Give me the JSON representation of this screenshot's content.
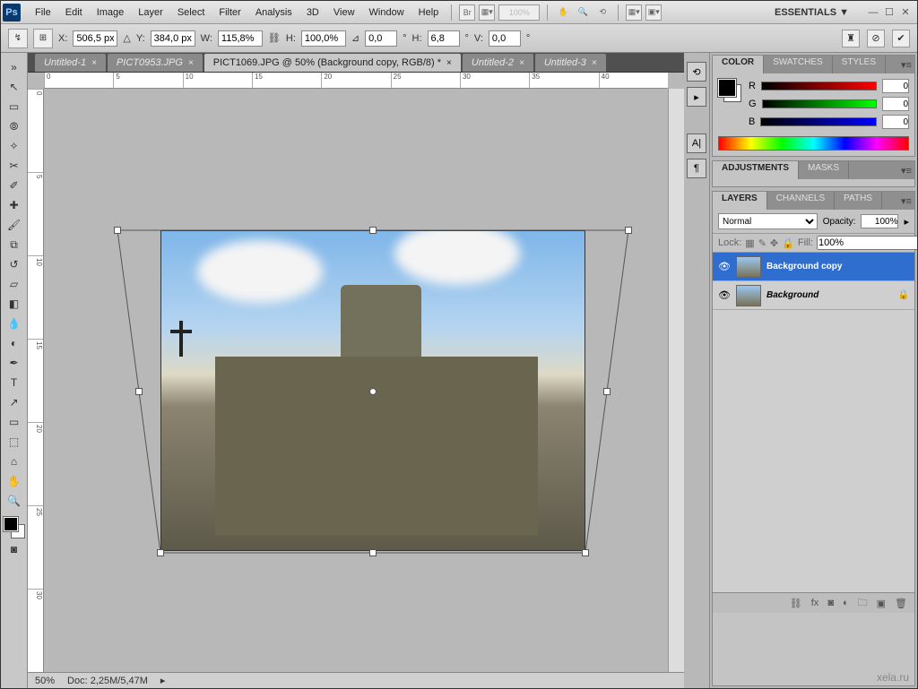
{
  "menu": {
    "items": [
      "File",
      "Edit",
      "Image",
      "Layer",
      "Select",
      "Filter",
      "Analysis",
      "3D",
      "View",
      "Window",
      "Help"
    ],
    "zoom_label": "100%"
  },
  "workspace": {
    "label": "ESSENTIALS ▼"
  },
  "options": {
    "x_label": "X:",
    "x_val": "506,5 px",
    "y_label": "Y:",
    "y_val": "384,0 px",
    "w_label": "W:",
    "w_val": "115,8%",
    "h_label": "H:",
    "h_val": "100,0%",
    "angle_label": "0,0",
    "angle_unit": "°",
    "h2_label": "H:",
    "h2_val": "6,8",
    "v_label": "V:",
    "v_val": "0,0",
    "v_unit": "°"
  },
  "tabs": [
    {
      "label": "Untitled-1",
      "active": false
    },
    {
      "label": "PICT0953.JPG",
      "active": false
    },
    {
      "label": "PICT1069.JPG @ 50% (Background copy, RGB/8) *",
      "active": true
    },
    {
      "label": "Untitled-2",
      "active": false
    },
    {
      "label": "Untitled-3",
      "active": false
    }
  ],
  "status": {
    "zoom": "50%",
    "docsize": "Doc: 2,25M/5,47M"
  },
  "color": {
    "tabs": [
      "COLOR",
      "SWATCHES",
      "STYLES"
    ],
    "r": "R",
    "rval": "0",
    "g": "G",
    "gval": "0",
    "b": "B",
    "bval": "0"
  },
  "adjustments": {
    "tabs": [
      "ADJUSTMENTS",
      "MASKS"
    ]
  },
  "layers": {
    "tabs": [
      "LAYERS",
      "CHANNELS",
      "PATHS"
    ],
    "blend": "Normal",
    "opacity_label": "Opacity:",
    "opacity_val": "100%",
    "lock_label": "Lock:",
    "fill_label": "Fill:",
    "fill_val": "100%",
    "items": [
      {
        "name": "Background copy",
        "selected": true,
        "locked": false
      },
      {
        "name": "Background",
        "selected": false,
        "locked": true
      }
    ]
  },
  "ruler_h": [
    "0",
    "5",
    "10",
    "15",
    "20",
    "25",
    "30",
    "35",
    "40"
  ],
  "ruler_v": [
    "0",
    "5",
    "10",
    "15",
    "20",
    "25",
    "30"
  ],
  "watermark": "xela.ru"
}
